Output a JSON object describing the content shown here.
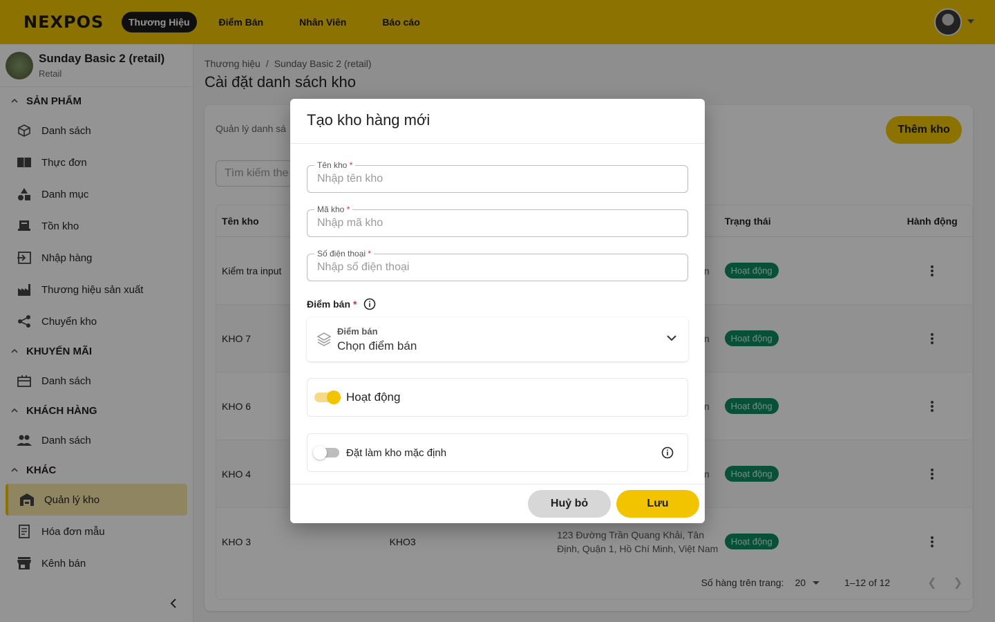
{
  "topbar": {
    "logo": "NEXPOS",
    "nav": [
      "Thương Hiệu",
      "Điểm Bán",
      "Nhân Viên",
      "Báo cáo"
    ]
  },
  "sidebar": {
    "brand_name": "Sunday Basic 2 (retail)",
    "brand_type": "Retail",
    "sections": [
      {
        "title": "SẢN PHẨM",
        "items": [
          "Danh sách",
          "Thực đơn",
          "Danh mục",
          "Tồn kho",
          "Nhập hàng",
          "Thương hiệu sản xuất",
          "Chuyển kho"
        ]
      },
      {
        "title": "KHUYẾN MÃI",
        "items": [
          "Danh sách"
        ]
      },
      {
        "title": "KHÁCH HÀNG",
        "items": [
          "Danh sách"
        ]
      },
      {
        "title": "KHÁC",
        "items": [
          "Quản lý kho",
          "Hóa đơn mẫu",
          "Kênh bán"
        ]
      }
    ]
  },
  "main": {
    "breadcrumb": [
      "Thương hiệu",
      "Sunday Basic 2 (retail)"
    ],
    "title": "Cài đặt danh sách kho",
    "description": "Quản lý danh sá",
    "add_button": "Thêm kho",
    "search_placeholder": "Tìm kiếm the",
    "table": {
      "headers": [
        "Tên kho",
        "",
        "",
        "Trạng thái",
        "Hành động"
      ],
      "rows": [
        {
          "name": "Kiểm tra input",
          "code": "",
          "address_tail": "n",
          "status": "Hoạt động"
        },
        {
          "name": "KHO 7",
          "code": "",
          "address_tail": "n",
          "status": "Hoạt động"
        },
        {
          "name": "KHO 6",
          "code": "",
          "address_tail": "n",
          "status": "Hoạt động"
        },
        {
          "name": "KHO 4",
          "code": "",
          "address_tail": "n",
          "status": "Hoạt động"
        },
        {
          "name": "KHO 3",
          "code": "KHO3",
          "address_tail": "123 Đường Trần Quang Khải, Tân Định, Quận 1, Hồ Chí Minh, Việt Nam",
          "status": "Hoạt động"
        }
      ]
    },
    "pager": {
      "rows_per_page_label": "Số hàng trên trang:",
      "rows_per_page": "20",
      "range": "1–12 of 12"
    }
  },
  "modal": {
    "title": "Tạo kho hàng mới",
    "fields": [
      {
        "label": "Tên kho",
        "placeholder": "Nhập tên kho"
      },
      {
        "label": "Mã kho",
        "placeholder": "Nhập mã kho"
      },
      {
        "label": "Số điện thoại",
        "placeholder": "Nhập số điện thoại"
      }
    ],
    "required_mark": "*",
    "pos_label": "Điểm bán",
    "pos_select_label": "Điểm bán",
    "pos_select_value": "Chọn điểm bán",
    "active_label": "Hoạt động",
    "default_label": "Đặt làm kho mặc định",
    "cancel": "Huỷ bỏ",
    "save": "Lưu"
  },
  "colors": {
    "brand": "#f2c400",
    "status": "#0e8a5f"
  }
}
